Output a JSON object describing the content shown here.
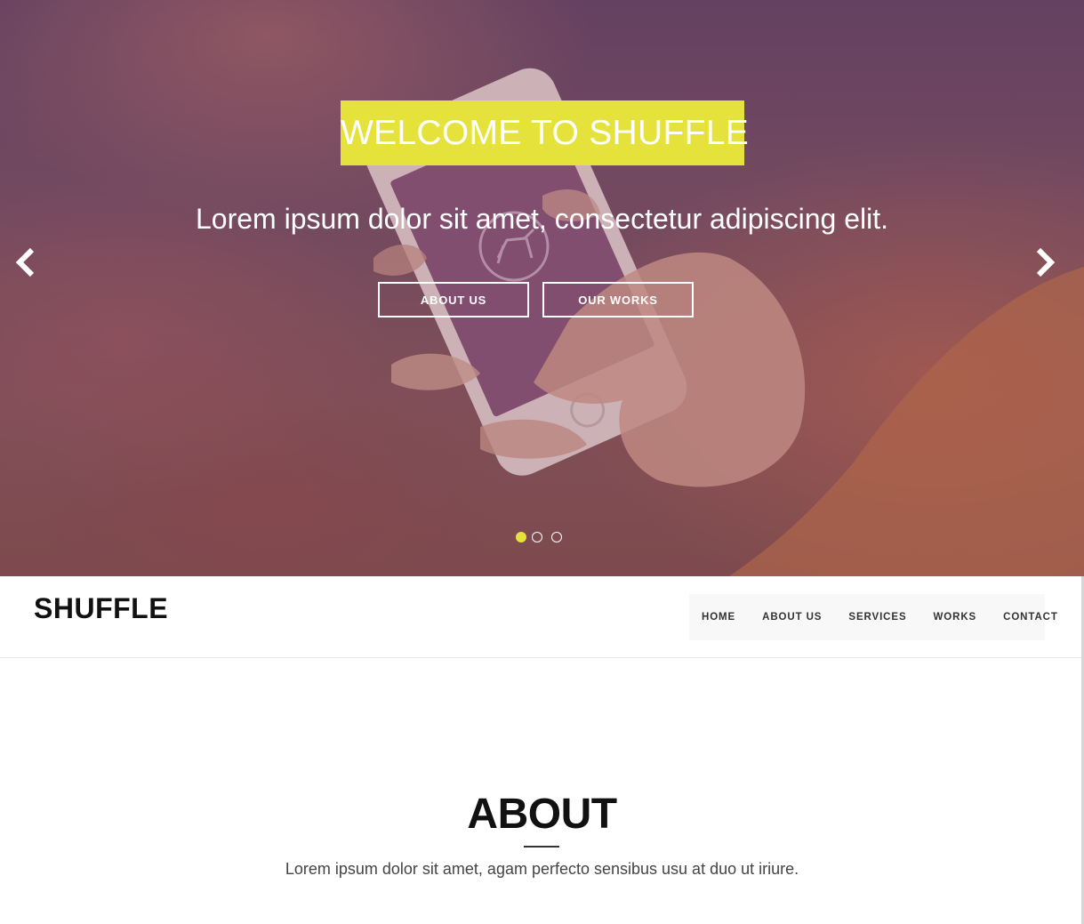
{
  "hero": {
    "title": "WELCOME TO SHUFFLE",
    "subtitle": "Lorem ipsum dolor sit amet, consectetur adipiscing elit.",
    "buttons": [
      {
        "label": "ABOUT US"
      },
      {
        "label": "OUR WORKS"
      }
    ],
    "slides_total": 3,
    "active_slide": 1,
    "accent_color": "#e5e23c",
    "icons": [
      "chevron-left-icon",
      "chevron-right-icon"
    ]
  },
  "navbar": {
    "brand": "SHUFFLE",
    "items": [
      {
        "label": "HOME"
      },
      {
        "label": "ABOUT US"
      },
      {
        "label": "SERVICES"
      },
      {
        "label": "WORKS"
      },
      {
        "label": "CONTACT"
      }
    ]
  },
  "about": {
    "title": "ABOUT",
    "text": "Lorem ipsum dolor sit amet, agam perfecto sensibus usu at duo ut iriure."
  }
}
